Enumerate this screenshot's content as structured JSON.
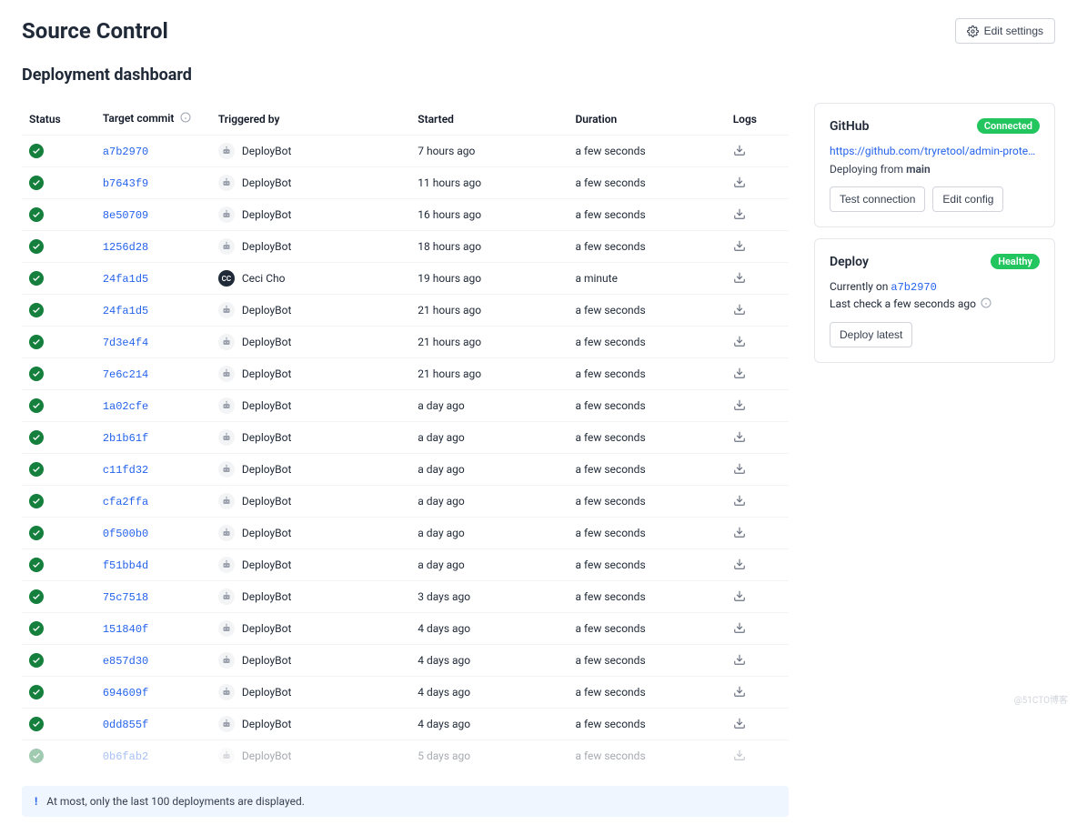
{
  "header": {
    "title": "Source Control",
    "edit_btn": "Edit settings"
  },
  "subtitle": "Deployment dashboard",
  "table": {
    "columns": [
      "Status",
      "Target commit",
      "Triggered by",
      "Started",
      "Duration",
      "Logs"
    ],
    "rows": [
      {
        "commit": "a7b2970",
        "by": "DeployBot",
        "avatar": "bot",
        "started": "7 hours ago",
        "duration": "a few seconds"
      },
      {
        "commit": "b7643f9",
        "by": "DeployBot",
        "avatar": "bot",
        "started": "11 hours ago",
        "duration": "a few seconds"
      },
      {
        "commit": "8e50709",
        "by": "DeployBot",
        "avatar": "bot",
        "started": "16 hours ago",
        "duration": "a few seconds"
      },
      {
        "commit": "1256d28",
        "by": "DeployBot",
        "avatar": "bot",
        "started": "18 hours ago",
        "duration": "a few seconds"
      },
      {
        "commit": "24fa1d5",
        "by": "Ceci Cho",
        "avatar": "user",
        "initials": "CC",
        "started": "19 hours ago",
        "duration": "a minute"
      },
      {
        "commit": "24fa1d5",
        "by": "DeployBot",
        "avatar": "bot",
        "started": "21 hours ago",
        "duration": "a few seconds"
      },
      {
        "commit": "7d3e4f4",
        "by": "DeployBot",
        "avatar": "bot",
        "started": "21 hours ago",
        "duration": "a few seconds"
      },
      {
        "commit": "7e6c214",
        "by": "DeployBot",
        "avatar": "bot",
        "started": "21 hours ago",
        "duration": "a few seconds"
      },
      {
        "commit": "1a02cfe",
        "by": "DeployBot",
        "avatar": "bot",
        "started": "a day ago",
        "duration": "a few seconds"
      },
      {
        "commit": "2b1b61f",
        "by": "DeployBot",
        "avatar": "bot",
        "started": "a day ago",
        "duration": "a few seconds"
      },
      {
        "commit": "c11fd32",
        "by": "DeployBot",
        "avatar": "bot",
        "started": "a day ago",
        "duration": "a few seconds"
      },
      {
        "commit": "cfa2ffa",
        "by": "DeployBot",
        "avatar": "bot",
        "started": "a day ago",
        "duration": "a few seconds"
      },
      {
        "commit": "0f500b0",
        "by": "DeployBot",
        "avatar": "bot",
        "started": "a day ago",
        "duration": "a few seconds"
      },
      {
        "commit": "f51bb4d",
        "by": "DeployBot",
        "avatar": "bot",
        "started": "a day ago",
        "duration": "a few seconds"
      },
      {
        "commit": "75c7518",
        "by": "DeployBot",
        "avatar": "bot",
        "started": "3 days ago",
        "duration": "a few seconds"
      },
      {
        "commit": "151840f",
        "by": "DeployBot",
        "avatar": "bot",
        "started": "4 days ago",
        "duration": "a few seconds"
      },
      {
        "commit": "e857d30",
        "by": "DeployBot",
        "avatar": "bot",
        "started": "4 days ago",
        "duration": "a few seconds"
      },
      {
        "commit": "694609f",
        "by": "DeployBot",
        "avatar": "bot",
        "started": "4 days ago",
        "duration": "a few seconds"
      },
      {
        "commit": "0dd855f",
        "by": "DeployBot",
        "avatar": "bot",
        "started": "4 days ago",
        "duration": "a few seconds"
      },
      {
        "commit": "0b6fab2",
        "by": "DeployBot",
        "avatar": "bot",
        "started": "5 days ago",
        "duration": "a few seconds",
        "faded": true
      }
    ]
  },
  "notice": "At most, only the last 100 deployments are displayed.",
  "github": {
    "title": "GitHub",
    "badge": "Connected",
    "link": "https://github.com/tryretool/admin-protected-...",
    "deploy_from_prefix": "Deploying from ",
    "deploy_from_branch": "main",
    "test_btn": "Test connection",
    "edit_btn": "Edit config"
  },
  "deploy": {
    "title": "Deploy",
    "badge": "Healthy",
    "current_prefix": "Currently on ",
    "current_commit": "a7b2970",
    "last_check": "Last check a few seconds ago",
    "deploy_btn": "Deploy latest"
  },
  "watermark": "@51CTO博客"
}
